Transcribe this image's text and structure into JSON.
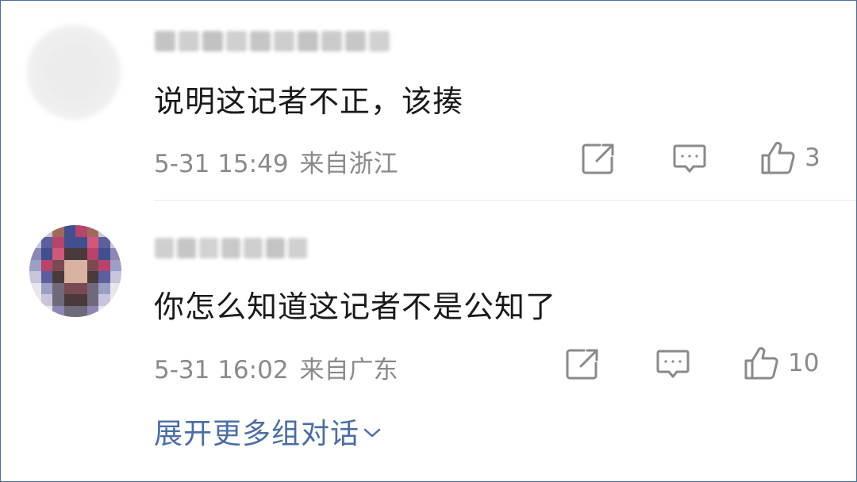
{
  "comments": [
    {
      "text": "说明这记者不正，该揍",
      "date": "5-31 15:49",
      "location": "来自浙江",
      "likes": "3",
      "avatar_icon": "blurred-avatar-icon",
      "username_blurred": true
    },
    {
      "text": "你怎么知道这记者不是公知了",
      "date": "5-31 16:02",
      "location": "来自广东",
      "likes": "10",
      "avatar_icon": "pixelated-avatar-icon",
      "username_blurred": true
    }
  ],
  "footer": {
    "expand_label": "展开更多组对话"
  },
  "icons": {
    "share": "share-icon",
    "reply": "comment-icon",
    "like": "thumbs-up-icon",
    "expand": "chevron-down-icon"
  },
  "colors": {
    "text": "#1a1a1a",
    "meta": "#8a8a8a",
    "link": "#4a6da7",
    "border": "#4a6da7"
  }
}
